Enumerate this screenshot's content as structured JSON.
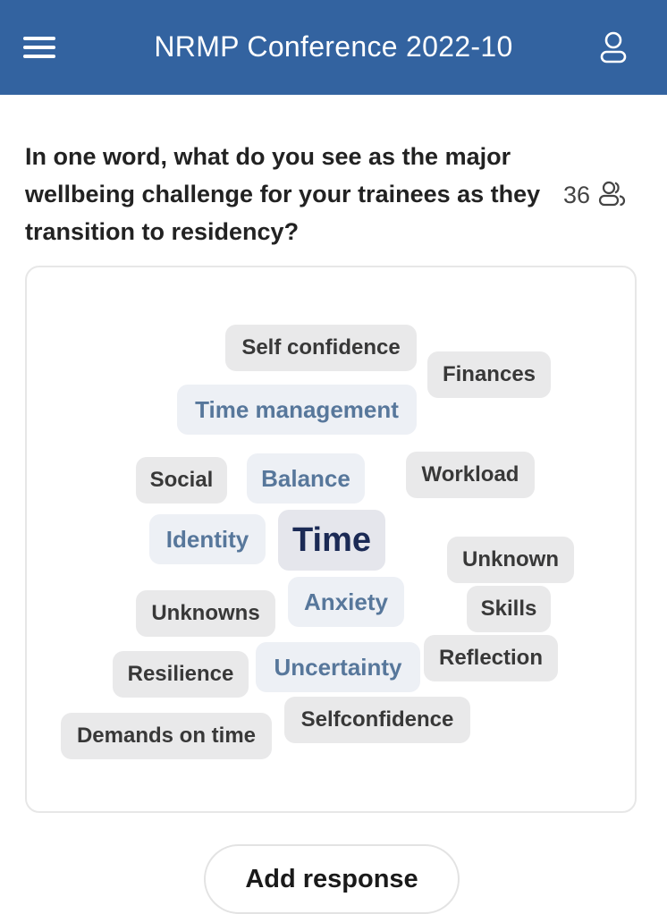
{
  "header": {
    "title": "NRMP Conference 2022-10",
    "menu_icon": "hamburger-menu-icon",
    "user_icon": "user-icon",
    "background_color": "#3363a0"
  },
  "question": {
    "text": "In one word, what do you see as the major wellbeing challenge for your trainees as they transition to residency?",
    "participant_count": "36",
    "participants_icon": "participants-icon"
  },
  "word_cloud": [
    {
      "text": "Self confidence",
      "style": "gray"
    },
    {
      "text": "Finances",
      "style": "gray"
    },
    {
      "text": "Time management",
      "style": "blue"
    },
    {
      "text": "Social",
      "style": "gray"
    },
    {
      "text": "Balance",
      "style": "blue"
    },
    {
      "text": "Workload",
      "style": "gray"
    },
    {
      "text": "Identity",
      "style": "blue"
    },
    {
      "text": "Time",
      "style": "emphasis"
    },
    {
      "text": "Unknown",
      "style": "gray"
    },
    {
      "text": "Unknowns",
      "style": "gray"
    },
    {
      "text": "Anxiety",
      "style": "blue"
    },
    {
      "text": "Skills",
      "style": "gray"
    },
    {
      "text": "Resilience",
      "style": "gray"
    },
    {
      "text": "Uncertainty",
      "style": "blue"
    },
    {
      "text": "Reflection",
      "style": "gray"
    },
    {
      "text": "Demands on time",
      "style": "gray"
    },
    {
      "text": "Selfconfidence",
      "style": "gray"
    }
  ],
  "actions": {
    "add_response_label": "Add response"
  }
}
